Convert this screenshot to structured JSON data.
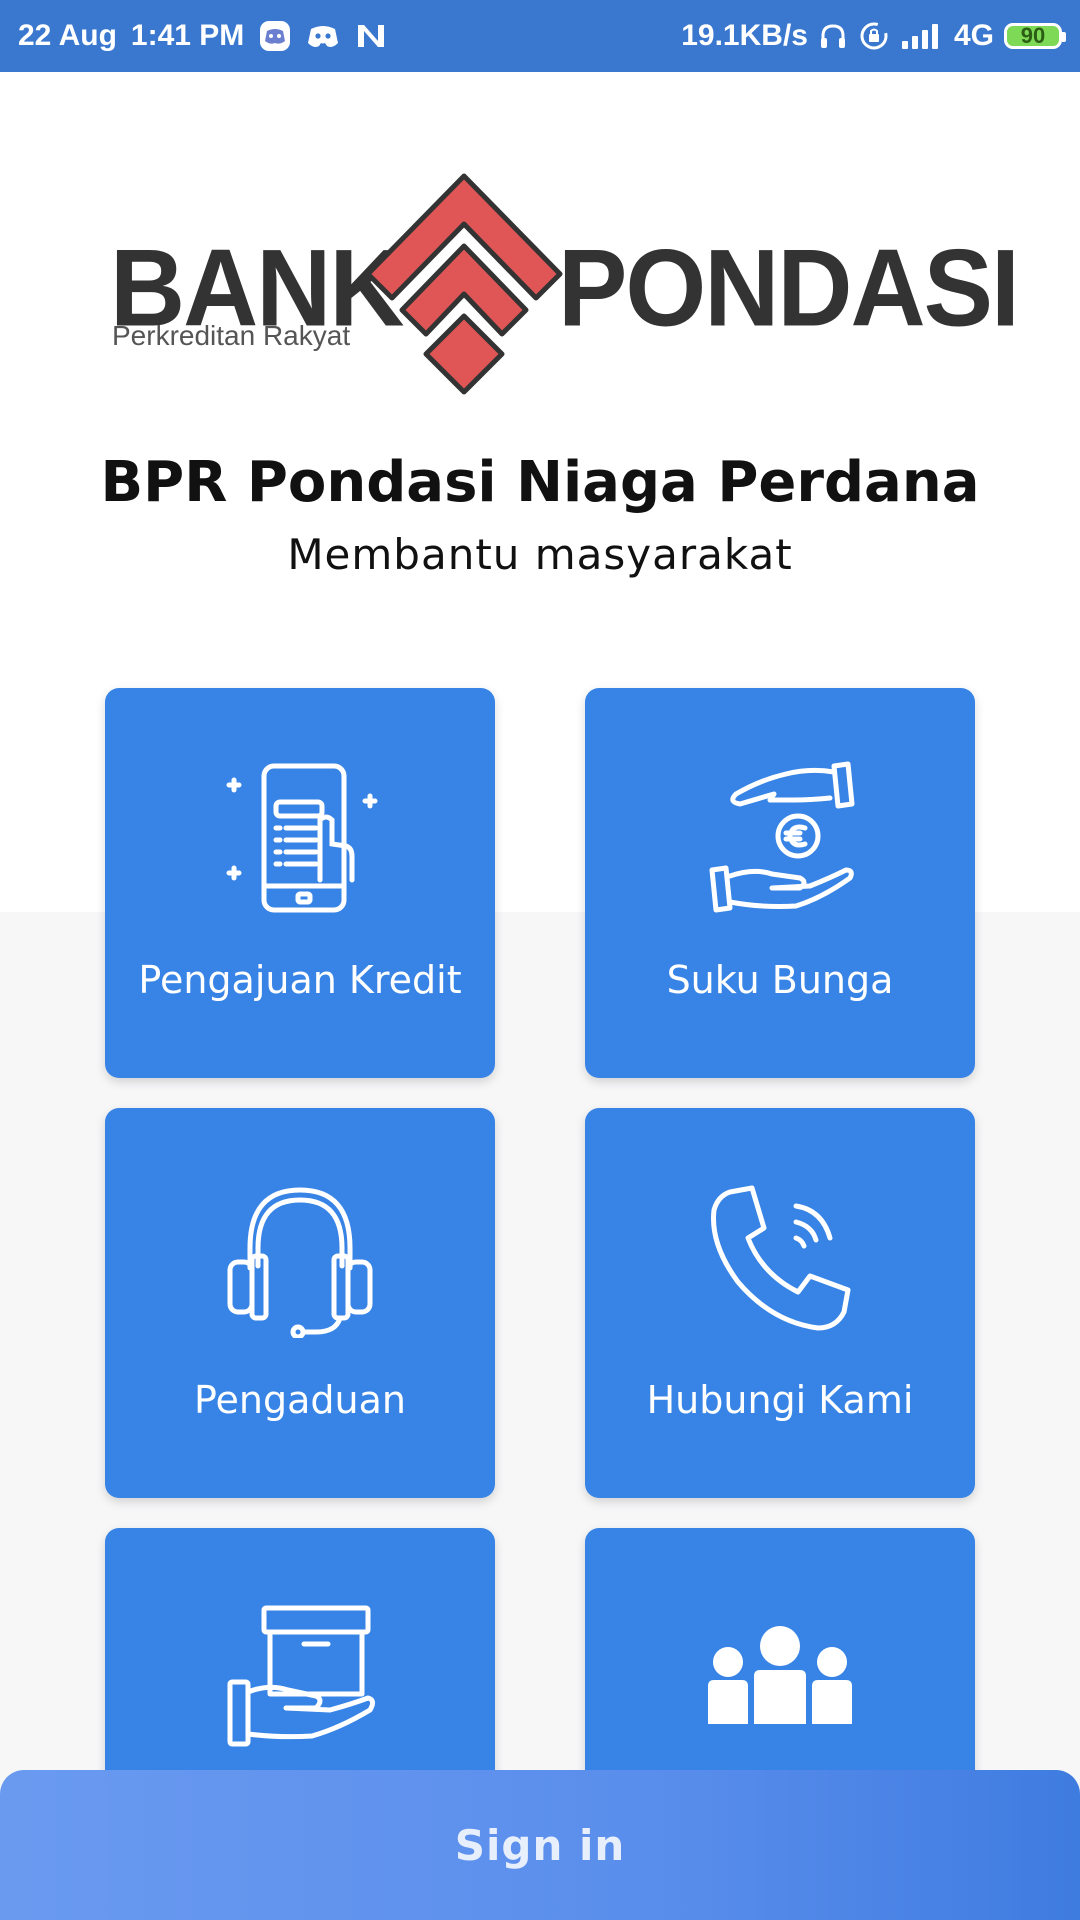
{
  "status_bar": {
    "date": "22 Aug",
    "time": "1:41 PM",
    "network_speed": "19.1KB/s",
    "network_type": "4G",
    "battery_level": "90",
    "icons": [
      "discord-bubble-icon",
      "discord-icon",
      "n-app-icon",
      "headphones-icon",
      "rotation-lock-icon",
      "signal-icon",
      "battery-icon"
    ]
  },
  "logo": {
    "word_left": "BANK",
    "word_right": "PONDASI",
    "subtitle": "Perkreditan Rakyat",
    "mark_color": "#e05555",
    "text_color": "#333333"
  },
  "header": {
    "bank_name": "BPR Pondasi Niaga Perdana",
    "tagline": "Membantu masyarakat"
  },
  "menu": {
    "items": [
      {
        "label": "Pengajuan Kredit",
        "icon": "tablet-form-icon"
      },
      {
        "label": "Suku Bunga",
        "icon": "hand-coin-icon"
      },
      {
        "label": "Pengaduan",
        "icon": "headset-icon"
      },
      {
        "label": "Hubungi Kami",
        "icon": "phone-call-icon"
      },
      {
        "label": "",
        "icon": "hand-box-icon"
      },
      {
        "label": "",
        "icon": "people-group-icon"
      }
    ]
  },
  "signin": {
    "label": "Sign in"
  },
  "colors": {
    "status_bar": "#3a78d0",
    "card": "#3784e6",
    "signin": "#5a8eec"
  }
}
